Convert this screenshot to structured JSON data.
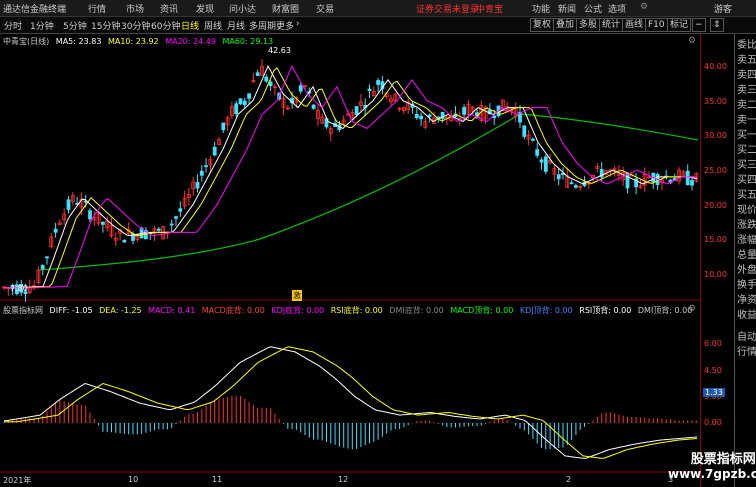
{
  "menubar": {
    "app_title": "通达信金融终端",
    "items": [
      "行情",
      "市场",
      "资讯",
      "发现",
      "问小达",
      "财富圈",
      "交易"
    ],
    "login_notice": "证券交易未登录",
    "stock_name": "中青宝",
    "right_items": [
      "功能",
      "新闻",
      "公式",
      "选项"
    ],
    "user": "游客"
  },
  "toolbar": {
    "periods": [
      "分时",
      "1分钟",
      "5分钟",
      "15分钟",
      "30分钟",
      "60分钟",
      "日线",
      "周线",
      "月线",
      "多周期",
      "更多"
    ],
    "active_period": "日线",
    "more_arrow": "›",
    "right_buttons": [
      "复权",
      "叠加",
      "多股",
      "统计",
      "画线",
      "F10",
      "标记"
    ],
    "minus": "−",
    "small_icon": "⇕"
  },
  "price_info": {
    "title": "中青宝(日线)",
    "ma5": "MA5: 23.83",
    "ma10": "MA10: 23.92",
    "ma20": "MA20: 24.49",
    "ma60": "MA60: 29.13",
    "high_marker": "42.63",
    "low_marker": "7.80",
    "colors": {
      "ma5": "#ffffff",
      "ma10": "#ffff00",
      "ma20": "#ff00ff",
      "ma60": "#00ff00"
    }
  },
  "indicator_info": {
    "title": "股票指标网",
    "diff": "DIFF: -1.05",
    "dea": "DEA: -1.25",
    "macd": "MACD: 0.41",
    "macd_bottom": "MACD底背: 0.00",
    "kdj_bottom": "KDJ底背: 0.00",
    "rsi_bottom": "RSI底背: 0.00",
    "dmi_bottom": "DMI底背: 0.00",
    "macd_top": "MACD顶背: 0.00",
    "kdj_top": "KDJ顶背: 0.00",
    "rsi_top": "RSI顶背: 0.00",
    "dmi_top": "DMI顶背: 0.00"
  },
  "price_axis": [
    "40.00",
    "35.00",
    "30.00",
    "25.00",
    "20.00",
    "15.00",
    "10.00"
  ],
  "indicator_axis": [
    "6.00",
    "4.50",
    "3.00",
    "1.33",
    "0.00"
  ],
  "current_indicator_value": "1.33",
  "time_axis": [
    "2021年",
    "10",
    "11",
    "12",
    "2",
    "3"
  ],
  "event_marker": "激",
  "side_panel": {
    "items": [
      "委比",
      "卖五",
      "卖四",
      "卖三",
      "卖二",
      "卖一",
      "买一",
      "买二",
      "买三",
      "买四",
      "买五",
      "现价",
      "涨跌",
      "涨幅",
      "总量",
      "外盘",
      "换手",
      "净资",
      "收益"
    ],
    "bottom_items": [
      "自动",
      "行情"
    ]
  },
  "watermark": {
    "name": "股票指标网",
    "url": "www.7gpzb.com"
  },
  "chart_data": {
    "type": "candlestick",
    "title": "中青宝(日线)",
    "ylim": [
      5,
      45
    ],
    "price_max": 42.63,
    "price_min": 7.8,
    "moving_averages": [
      "MA5",
      "MA10",
      "MA20",
      "MA60"
    ],
    "indicator": {
      "type": "macd",
      "ylim": [
        -3.5,
        6.5
      ],
      "diff": -1.05,
      "dea": -1.25,
      "macd": 0.41
    }
  }
}
